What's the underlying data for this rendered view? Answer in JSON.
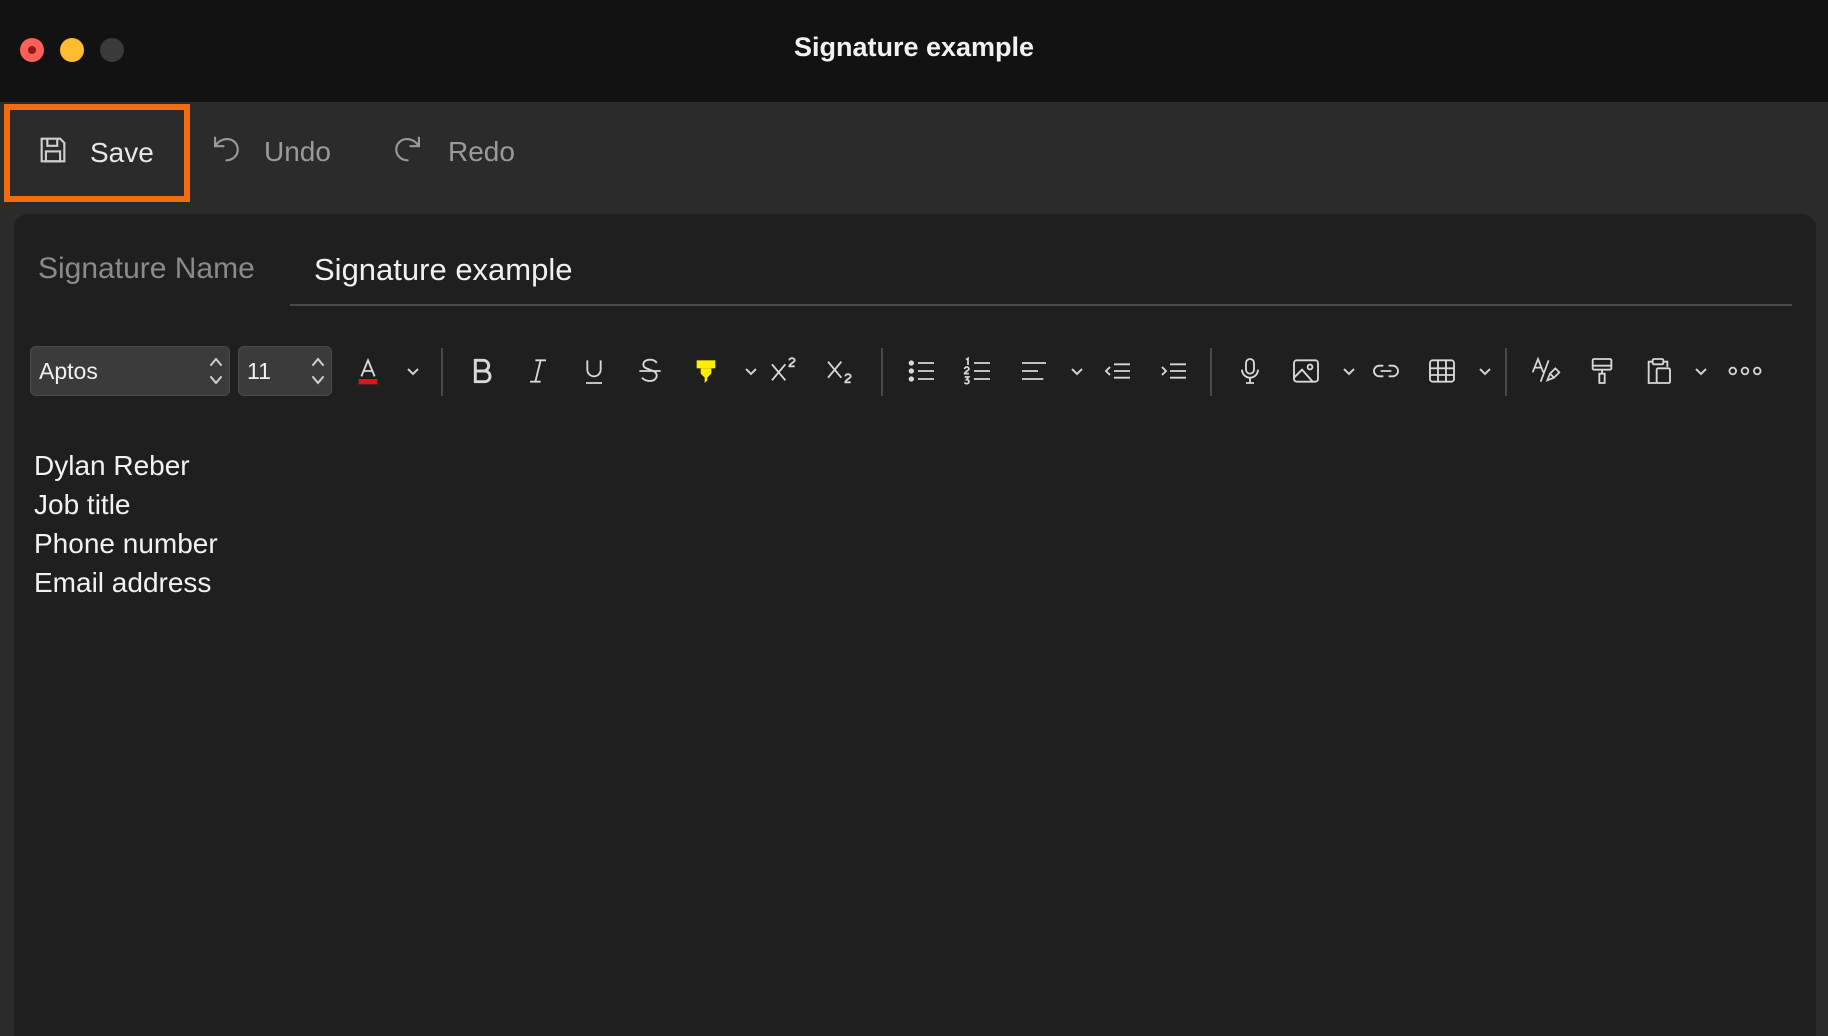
{
  "window": {
    "title": "Signature example",
    "traffic_lights": {
      "close": "#ff5f57",
      "minimize": "#febc2e",
      "zoom": "#3a3a3a"
    }
  },
  "command_bar": {
    "save_label": "Save",
    "undo_label": "Undo",
    "redo_label": "Redo",
    "highlight_color": "#f46b10"
  },
  "signature_name": {
    "label": "Signature Name",
    "value": "Signature example"
  },
  "toolbar": {
    "font": "Aptos",
    "font_size": "11",
    "font_color_swatch": "#e0141e",
    "highlight_swatch": "#ffee00",
    "icons": [
      "font-color-icon",
      "bold-icon",
      "italic-icon",
      "underline-icon",
      "strikethrough-icon",
      "highlight-icon",
      "superscript-icon",
      "subscript-icon",
      "bullet-list-icon",
      "numbered-list-icon",
      "align-icon",
      "decrease-indent-icon",
      "increase-indent-icon",
      "dictate-icon",
      "image-icon",
      "link-icon",
      "table-icon",
      "editor-icon",
      "format-painter-icon",
      "paste-icon",
      "more-icon"
    ]
  },
  "body": {
    "lines": [
      "Dylan Reber",
      "Job title",
      "Phone number",
      "Email address"
    ]
  }
}
